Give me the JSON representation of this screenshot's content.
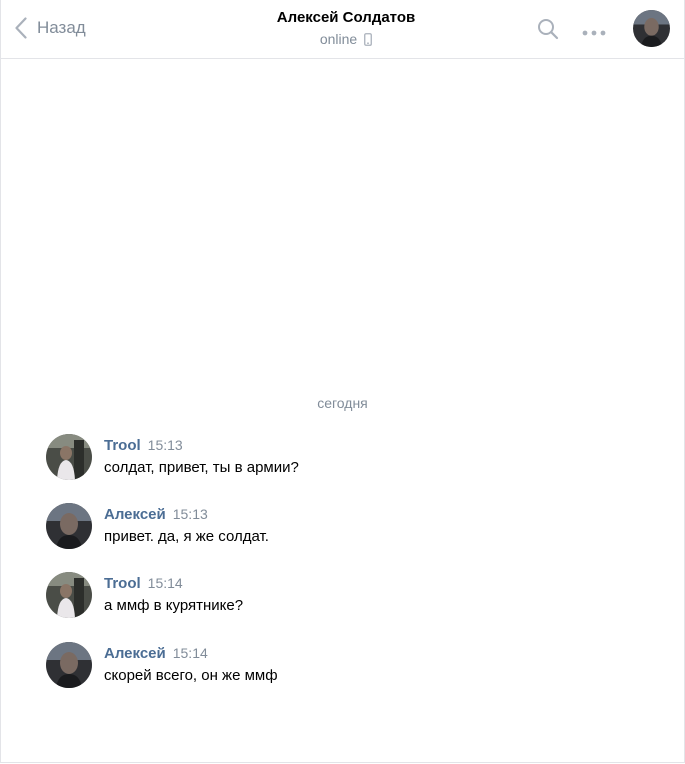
{
  "header": {
    "back_label": "Назад",
    "title": "Алексей Солдатов",
    "status": "online",
    "status_device_icon": "mobile-phone-icon",
    "search_icon": "search-icon",
    "more_icon": "more-dots-icon"
  },
  "chat": {
    "date_separator": "сегодня",
    "messages": [
      {
        "author": "Trool",
        "time": "15:13",
        "text": "солдат, привет, ты в армии?",
        "avatar": "trool-avatar"
      },
      {
        "author": "Алексей",
        "time": "15:13",
        "text": "привет. да, я же солдат.",
        "avatar": "aleksey-avatar"
      },
      {
        "author": "Trool",
        "time": "15:14",
        "text": "а ммф в курятнике?",
        "avatar": "trool-avatar"
      },
      {
        "author": "Алексей",
        "time": "15:14",
        "text": "скорей всего, он же ммф",
        "avatar": "aleksey-avatar"
      }
    ]
  },
  "colors": {
    "author_link": "#4b6d94",
    "secondary_text": "#818c99",
    "border": "#e3e4e8",
    "background": "#ffffff"
  }
}
